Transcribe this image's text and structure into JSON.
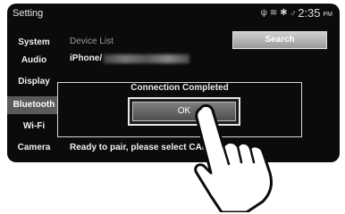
{
  "header": {
    "title": "Setting",
    "time": "2:35",
    "ampm": "PM",
    "status_icons": [
      "phone-signal-icon",
      "wifi-icon",
      "bluetooth-icon",
      "no-signal-icon"
    ]
  },
  "sidebar": {
    "items": [
      {
        "label": "System",
        "active": false
      },
      {
        "label": "Audio",
        "active": false
      },
      {
        "label": "Display",
        "active": false
      },
      {
        "label": "Bluetooth",
        "active": true
      },
      {
        "label": "Wi-Fi",
        "active": false
      },
      {
        "label": "Camera",
        "active": false
      }
    ]
  },
  "main": {
    "column_header": "Device List",
    "search_label": "Search",
    "device_prefix": "iPhone/",
    "instruction": "Ready to pair, please select CAR"
  },
  "dialog": {
    "title": "Connection Completed",
    "ok_label": "OK"
  }
}
